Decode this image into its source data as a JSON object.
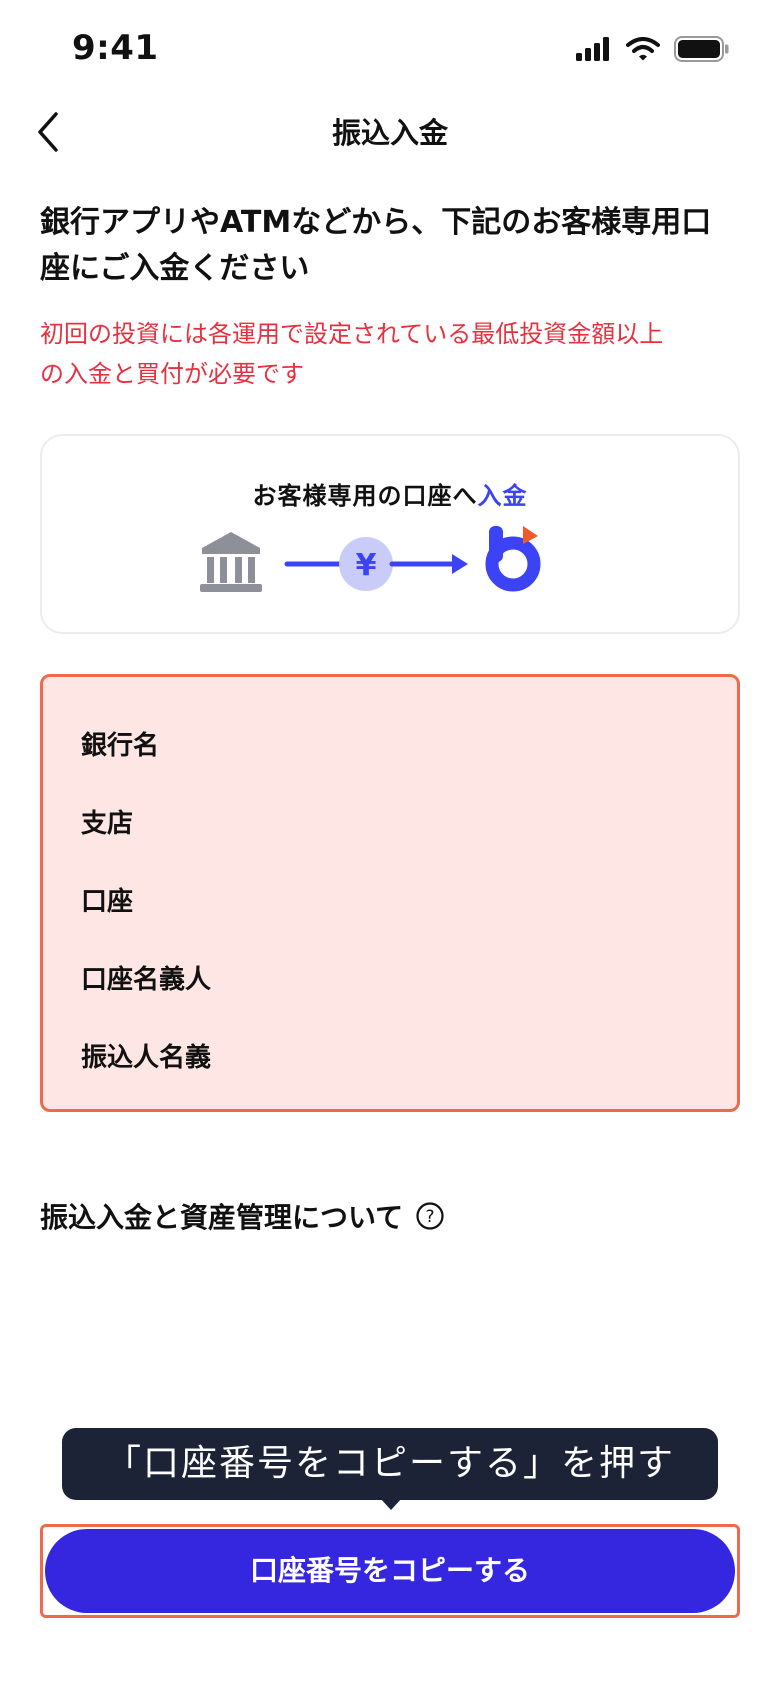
{
  "status_bar": {
    "time": "9:41"
  },
  "nav": {
    "title": "振込入金"
  },
  "intro": {
    "line1": "銀行アプリやATMなどから、下記のお客様専用口",
    "line2": "座にご入金ください"
  },
  "warning": {
    "line1": "初回の投資には各運用で設定されている最低投資金額以上",
    "line2": "の入金と買付が必要です"
  },
  "flow_card": {
    "title_prefix": "お客様専用の口座へ",
    "title_accent": "入金",
    "yen_symbol": "¥"
  },
  "account_details": {
    "bank_name_label": "銀行名",
    "branch_label": "支店",
    "account_label": "口座",
    "holder_label": "口座名義人",
    "sender_label": "振込人名義"
  },
  "about": {
    "label": "振込入金と資産管理について",
    "icon": "?"
  },
  "tooltip": {
    "text": "「口座番号をコピーする」を押す"
  },
  "copy_button": {
    "label": "口座番号をコピーする"
  },
  "colors": {
    "accent": "#3b43f5",
    "button": "#3527e0",
    "warning": "#e8313f",
    "highlight_border": "#ef6a4d",
    "highlight_bg": "#fde6e3",
    "tooltip_bg": "#1c2337"
  }
}
